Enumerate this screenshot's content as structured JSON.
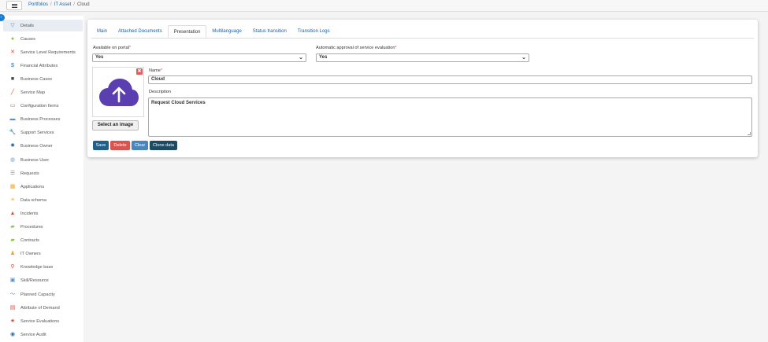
{
  "breadcrumb": {
    "portfolios": "Portfolios",
    "it_asset": "IT Asset",
    "current": "Cloud",
    "sep": "/"
  },
  "sidebar": {
    "items": [
      {
        "label": "Details",
        "icon": "filter-icon",
        "color": "#4a90d9"
      },
      {
        "label": "Causes",
        "icon": "causes-icon",
        "color": "#8bc34a"
      },
      {
        "label": "Service Level Requirements",
        "icon": "tools-icon",
        "color": "#e04b3c"
      },
      {
        "label": "Financial Attributes",
        "icon": "dollar-icon",
        "color": "#2a6fb0"
      },
      {
        "label": "Business Cases",
        "icon": "briefcase-icon",
        "color": "#444444"
      },
      {
        "label": "Service Map",
        "icon": "pencil-icon",
        "color": "#e04b3c"
      },
      {
        "label": "Configuration Items",
        "icon": "monitor-icon",
        "color": "#e04b3c"
      },
      {
        "label": "Business Processes",
        "icon": "toolbox-icon",
        "color": "#5b8def"
      },
      {
        "label": "Support Services",
        "icon": "wrench-icon",
        "color": "#666666"
      },
      {
        "label": "Business Owner",
        "icon": "gear-icon",
        "color": "#2a6fb0"
      },
      {
        "label": "Business User",
        "icon": "globe-icon",
        "color": "#6aa3d8"
      },
      {
        "label": "Requests",
        "icon": "list-icon",
        "color": "#4a90d9"
      },
      {
        "label": "Applications",
        "icon": "grid-icon",
        "color": "#f5a623"
      },
      {
        "label": "Data schema",
        "icon": "list-lines-icon",
        "color": "#f5a623"
      },
      {
        "label": "Incidents",
        "icon": "warning-icon",
        "color": "#e04b3c"
      },
      {
        "label": "Procedures",
        "icon": "procedures-icon",
        "color": "#8bc34a"
      },
      {
        "label": "Contracts",
        "icon": "folder-icon",
        "color": "#8bc34a"
      },
      {
        "label": "IT Owners",
        "icon": "users-icon",
        "color": "#f5a623"
      },
      {
        "label": "Knowledge base",
        "icon": "pin-icon",
        "color": "#e04b3c"
      },
      {
        "label": "Skill/Resource",
        "icon": "id-card-icon",
        "color": "#4a90d9"
      },
      {
        "label": "Planned Capacity",
        "icon": "chart-line-icon",
        "color": "#4a90d9"
      },
      {
        "label": "Attribute of Demand",
        "icon": "table-icon",
        "color": "#e04b3c"
      },
      {
        "label": "Service Evaluations",
        "icon": "star-icon",
        "color": "#e04b3c"
      },
      {
        "label": "Service Audit",
        "icon": "eye-icon",
        "color": "#2a6fb0"
      }
    ]
  },
  "tabs": [
    {
      "label": "Main"
    },
    {
      "label": "Attached Documents"
    },
    {
      "label": "Presentation",
      "active": true
    },
    {
      "label": "Multilanguage"
    },
    {
      "label": "Status transition"
    },
    {
      "label": "Transition Logs"
    }
  ],
  "form": {
    "portal_label": "Available on portal",
    "portal_value": "Yes",
    "auto_approval_label": "Automatic approval of service evaluation",
    "auto_approval_value": "Yes",
    "required_mark": "*",
    "name_label": "Name",
    "name_value": "Cloud",
    "description_label": "Description",
    "description_value": "Request Cloud Services",
    "select_image_label": "Select an image",
    "image_icon": "cloud-upload-icon",
    "image_color": "#5b3fb0"
  },
  "buttons": {
    "save": "Save",
    "delete": "Delete",
    "clear": "Clear",
    "clone": "Clone data"
  }
}
